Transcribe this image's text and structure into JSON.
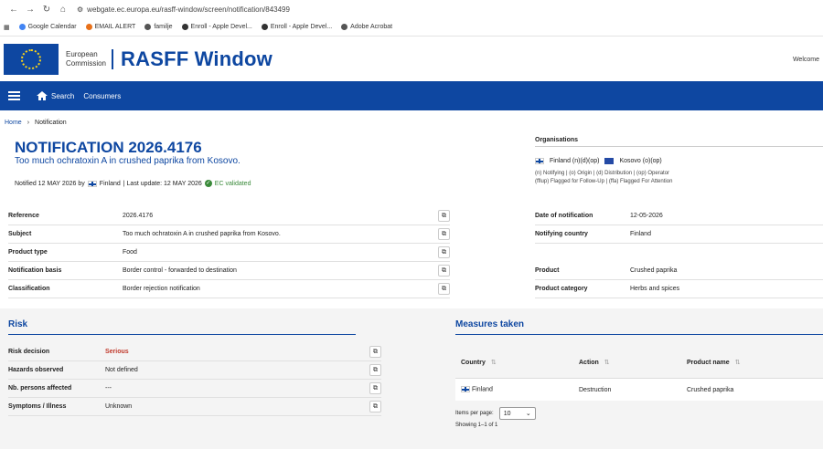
{
  "browser": {
    "url": "webgate.ec.europa.eu/rasff-window/screen/notification/843499",
    "bookmarks": [
      "Google Calendar",
      "EMAIL ALERT",
      "familje",
      "Enroll - Apple Devel...",
      "Enroll - Apple Devel...",
      "Adobe Acrobat"
    ]
  },
  "header": {
    "logo_line1": "European",
    "logo_line2": "Commission",
    "app_title": "RASFF Window",
    "welcome": "Welcome"
  },
  "menu": {
    "search": "Search",
    "consumers": "Consumers"
  },
  "breadcrumb": {
    "home": "Home",
    "current": "Notification"
  },
  "notification": {
    "title": "NOTIFICATION 2026.4176",
    "subtitle": "Too much ochratoxin A in crushed paprika from Kosovo.",
    "notified_prefix": "Notified 12 MAY 2026 by",
    "notified_country": "Finland",
    "last_update": "| Last update: 12 MAY 2026",
    "validated": "EC validated"
  },
  "organisations": {
    "title": "Organisations",
    "org1": "Finland (n)(d)(op)",
    "org2": "Kosovo (o)(op)",
    "legend1": "(n) Notifying | (o) Origin | (d) Distribution | (op) Operator",
    "legend2": "(fflup) Flagged for Follow-Up | (ffa) Flagged For Attention"
  },
  "details_left": [
    {
      "label": "Reference",
      "value": "2026.4176"
    },
    {
      "label": "Subject",
      "value": "Too much ochratoxin A in crushed paprika from Kosovo."
    },
    {
      "label": "Product type",
      "value": "Food"
    },
    {
      "label": "Notification basis",
      "value": "Border control - forwarded to destination"
    },
    {
      "label": "Classification",
      "value": "Border rejection notification"
    }
  ],
  "details_right": [
    {
      "label": "Date of notification",
      "value": "12-05-2026"
    },
    {
      "label": "Notifying country",
      "value": "Finland"
    },
    {
      "label": "Product",
      "value": "Crushed paprika"
    },
    {
      "label": "Product category",
      "value": "Herbs and spices"
    }
  ],
  "risk": {
    "title": "Risk",
    "rows": [
      {
        "label": "Risk decision",
        "value": "Serious"
      },
      {
        "label": "Hazards observed",
        "value": "Not defined"
      },
      {
        "label": "Nb. persons affected",
        "value": "---"
      },
      {
        "label": "Symptoms / Illness",
        "value": "Unknown"
      }
    ]
  },
  "measures": {
    "title": "Measures taken",
    "headers": [
      "Country",
      "Action",
      "Product name"
    ],
    "row": {
      "country": "Finland",
      "action": "Destruction",
      "product": "Crushed paprika"
    },
    "items_per_page_label": "Items per page:",
    "items_per_page": "10",
    "showing": "Showing 1–1 of 1"
  },
  "icons": {
    "copy": "copy-icon",
    "sort": "sort-icon"
  },
  "colors": {
    "brand": "#0e47a1",
    "serious": "#c0392b",
    "validated": "#3a8a3a"
  }
}
